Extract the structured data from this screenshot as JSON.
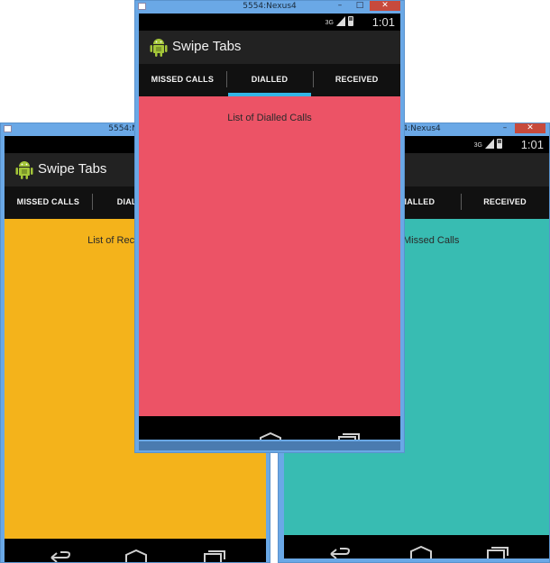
{
  "app": {
    "title": "Swipe Tabs"
  },
  "window": {
    "title": "5554:Nexus4",
    "min_label": "–",
    "max_label": "□",
    "close_label": "✕"
  },
  "status": {
    "network": "3G",
    "time": "1:01"
  },
  "tabs": {
    "missed": "MISSED CALLS",
    "dialled": "DIALLED",
    "received": "RECEIVED"
  },
  "screens": {
    "received": {
      "message": "List of Received Calls",
      "color": "#f4b31b"
    },
    "dialled": {
      "message": "List of Dialled Calls",
      "color": "#ec5366"
    },
    "missed": {
      "message": "List of Missed Calls",
      "color": "#38bcb2"
    }
  },
  "colors": {
    "tab_indicator": "#33b5e5",
    "action_bar": "#222222",
    "window_frame": "#6aa8e6",
    "close_button": "#c74a3c"
  },
  "icons": {
    "app": "android-robot-icon",
    "back": "back-arrow-icon",
    "home": "home-icon",
    "recents": "recent-apps-icon"
  }
}
